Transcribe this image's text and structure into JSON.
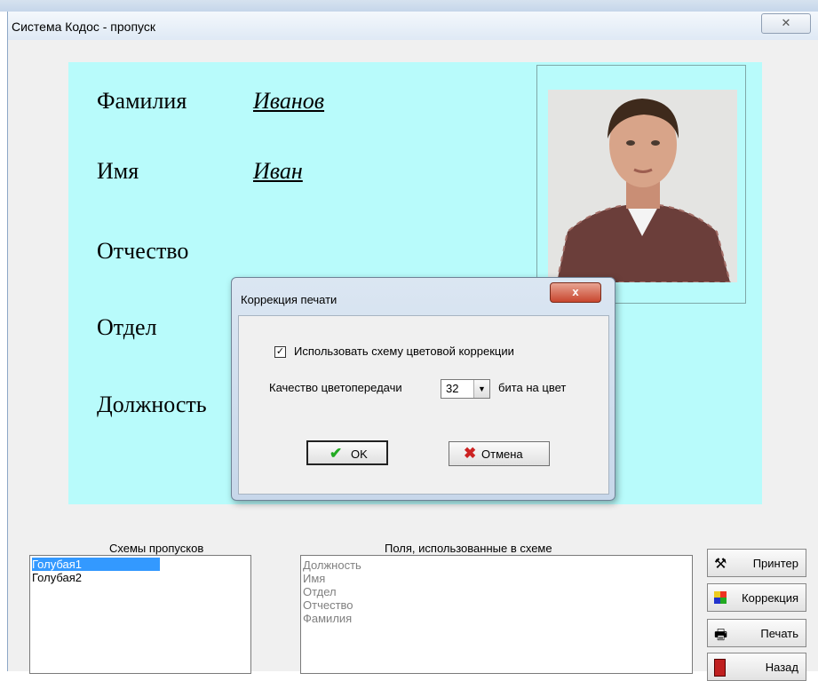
{
  "window": {
    "title": "Система Кодос - пропуск",
    "close_glyph": "✕"
  },
  "card": {
    "fields": [
      {
        "label": "Фамилия",
        "value": "Иванов"
      },
      {
        "label": "Имя",
        "value": "Иван"
      },
      {
        "label": "Отчество",
        "value": ""
      },
      {
        "label": "Отдел",
        "value": ""
      },
      {
        "label": "Должность",
        "value": ""
      }
    ]
  },
  "dialog": {
    "title": "Коррекция печати",
    "close_glyph": "x",
    "checkbox_label": "Использовать схему цветовой коррекции",
    "checkbox_checked": true,
    "quality_label": "Качество цветопередачи",
    "quality_value": "32",
    "quality_unit": "бита на цвет",
    "ok_label": "OK",
    "cancel_label": "Отмена"
  },
  "schemes": {
    "label": "Схемы пропусков",
    "items": [
      "Голубая1",
      "Голубая2"
    ],
    "selected_index": 0
  },
  "fields_used": {
    "label": "Поля, использованные в схеме",
    "items": [
      "Должность",
      "Имя",
      "Отдел",
      "Отчество",
      "Фамилия"
    ]
  },
  "side_buttons": {
    "printer": "Принтер",
    "correction": "Коррекция",
    "print": "Печать",
    "back": "Назад"
  },
  "colors": {
    "card_bg": "#b8fbfb",
    "selection": "#3399ff",
    "ok_icon": "#22aa22",
    "cancel_icon": "#cc2222"
  },
  "icons": [
    "printer-settings-icon",
    "color-scheme-icon",
    "printer-icon",
    "exit-door-icon",
    "checkmark-icon",
    "x-icon",
    "dropdown-arrow-icon"
  ]
}
